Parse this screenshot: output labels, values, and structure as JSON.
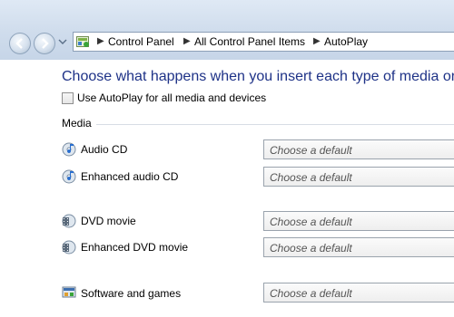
{
  "address_bar": {
    "crumbs": [
      "Control Panel",
      "All Control Panel Items",
      "AutoPlay"
    ]
  },
  "main": {
    "heading": "Choose what happens when you insert each type of media or d",
    "autoplay_checkbox": {
      "label": "Use AutoPlay for all media and devices",
      "checked": false
    },
    "section_title": "Media",
    "rows": [
      {
        "label": "Audio CD",
        "icon": "audio-cd-icon",
        "select": "Choose a default"
      },
      {
        "label": "Enhanced audio CD",
        "icon": "audio-cd-icon",
        "select": "Choose a default"
      },
      {
        "label": "DVD movie",
        "icon": "dvd-movie-icon",
        "select": "Choose a default"
      },
      {
        "label": "Enhanced DVD movie",
        "icon": "dvd-movie-icon",
        "select": "Choose a default"
      },
      {
        "label": "Software and games",
        "icon": "software-icon",
        "select": "Choose a default"
      }
    ]
  }
}
